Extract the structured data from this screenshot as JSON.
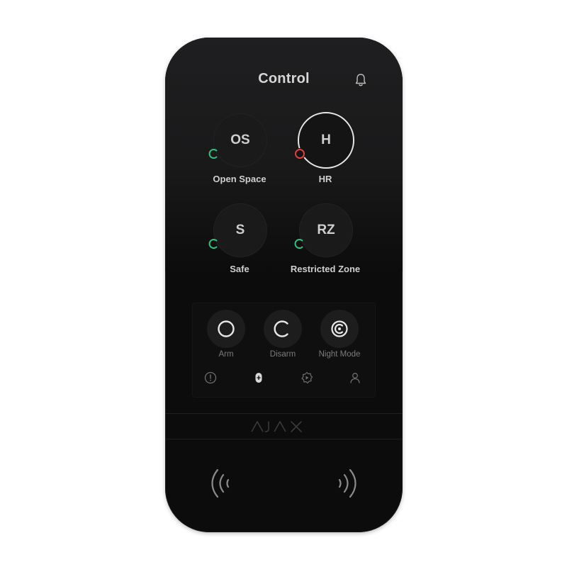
{
  "header": {
    "title": "Control",
    "bell_icon": "bell-icon"
  },
  "groups": [
    {
      "abbr": "OS",
      "name": "Open Space",
      "status": "disarmed",
      "status_color": "#2ec27e",
      "selected": false
    },
    {
      "abbr": "H",
      "name": "HR",
      "status": "armed",
      "status_color": "#e0413a",
      "selected": true
    },
    {
      "abbr": "S",
      "name": "Safe",
      "status": "disarmed",
      "status_color": "#2ec27e",
      "selected": false
    },
    {
      "abbr": "RZ",
      "name": "Restricted Zone",
      "status": "disarmed",
      "status_color": "#2ec27e",
      "selected": false
    }
  ],
  "modes": [
    {
      "label": "Arm",
      "icon": "arm-icon"
    },
    {
      "label": "Disarm",
      "icon": "disarm-icon"
    },
    {
      "label": "Night Mode",
      "icon": "night-mode-icon"
    }
  ],
  "tabs": [
    {
      "icon": "alarm-icon"
    },
    {
      "icon": "control-icon",
      "active": true
    },
    {
      "icon": "scenarios-icon"
    },
    {
      "icon": "user-icon"
    }
  ],
  "brand": {
    "logo_text": "AJAX"
  },
  "colors": {
    "body": "#0c0c0d",
    "text": "#d6d6d6",
    "green": "#2ec27e",
    "red": "#e0413a"
  }
}
